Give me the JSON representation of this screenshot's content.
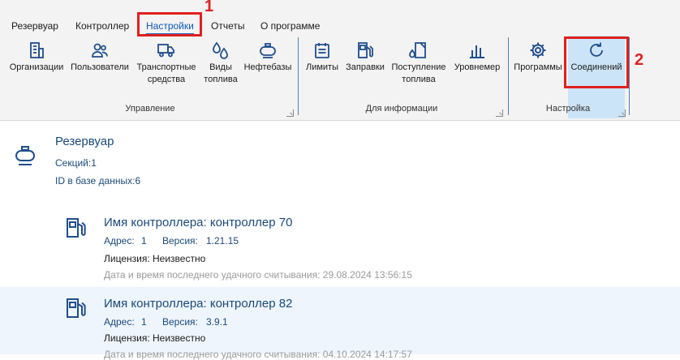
{
  "menu": {
    "tabs": [
      {
        "label": "Резервуар"
      },
      {
        "label": "Контроллер"
      },
      {
        "label": "Настройки"
      },
      {
        "label": "Отчеты"
      },
      {
        "label": "О программе"
      }
    ],
    "active_tab": "Настройки"
  },
  "ribbon": {
    "groups": [
      {
        "label": "Управление",
        "items": [
          {
            "label": "Организации"
          },
          {
            "label": "Пользователи"
          },
          {
            "label": "Транспортные\nсредства"
          },
          {
            "label": "Виды\nтоплива"
          },
          {
            "label": "Нефтебазы"
          }
        ]
      },
      {
        "label": "Для информации",
        "items": [
          {
            "label": "Лимиты"
          },
          {
            "label": "Заправки"
          },
          {
            "label": "Поступление\nтоплива"
          },
          {
            "label": "Уровнемер"
          }
        ]
      },
      {
        "label": "Настройка",
        "items": [
          {
            "label": "Программы"
          },
          {
            "label": "Соединений"
          }
        ]
      }
    ]
  },
  "annotations": {
    "marker_1": "1",
    "marker_2": "2"
  },
  "tank": {
    "title": "Резервуар",
    "sections": "Секций:1",
    "db_id": "ID в базе данных:6"
  },
  "controllers": [
    {
      "name": "Имя контроллера: контроллер 70",
      "address_label": "Адрес:",
      "address": "1",
      "version_label": "Версия:",
      "version": "1.21.15",
      "license": "Лицензия: Неизвестно",
      "last_read": "Дата и время последнего удачного считывания: 29.08.2024  13:56:15"
    },
    {
      "name": "Имя контроллера: контроллер 82",
      "address_label": "Адрес:",
      "address": "1",
      "version_label": "Версия:",
      "version": "3.9.1",
      "license": "Лицензия: Неизвестно",
      "last_read": "Дата и время последнего удачного считывания: 04.10.2024  14:17:57"
    }
  ],
  "colors": {
    "accent": "#1c6fd1",
    "annotation": "#e02020",
    "selected_bg": "#cce4f7",
    "text_blue": "#1a4a7a",
    "icon": "#1f4e8c"
  }
}
